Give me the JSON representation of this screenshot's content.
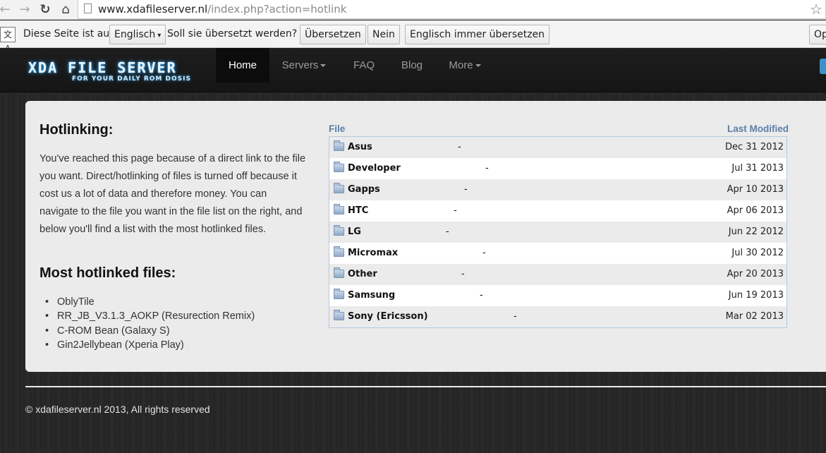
{
  "browser": {
    "url_domain": "www.xdafileserver.nl",
    "url_path": "/index.php?action=hotlink",
    "back_icon": "back-arrow-icon",
    "forward_icon": "forward-arrow-icon",
    "reload_icon": "reload-icon",
    "home_icon": "home-icon",
    "bookmark_icon": "star-icon"
  },
  "translate_bar": {
    "prefix": "Diese Seite ist auf",
    "language": "Englisch",
    "question": "Soll sie übersetzt werden?",
    "translate_label": "Übersetzen",
    "no_label": "Nein",
    "always_label": "Englisch immer übersetzen",
    "options_label": "Op"
  },
  "site": {
    "logo_title": "XDA FILE SERVER",
    "logo_tagline": "FOR YOUR DAILY ROM DOSIS",
    "nav": [
      {
        "label": "Home",
        "active": true
      },
      {
        "label": "Servers",
        "dropdown": true
      },
      {
        "label": "FAQ"
      },
      {
        "label": "Blog"
      },
      {
        "label": "More",
        "dropdown": true
      }
    ],
    "accent_color": "#2aa8ff"
  },
  "main": {
    "heading": "Hotlinking:",
    "intro": "You've reached this page because of a direct link to the file you want. Direct/hotlinking of files is turned off because it cost us a lot of data and therefore money. You can navigate to the file you want in the file list on the right, and below you'll find a list with the most hotlinked files.",
    "most_heading": "Most hotlinked files:",
    "most_hotlinked": [
      "OblyTile",
      "RR_JB_V3.1.3_AOKP (Resurection Remix)",
      "C-ROM Bean (Galaxy S)",
      "Gin2Jellybean (Xperia Play)"
    ]
  },
  "file_table": {
    "col_file": "File",
    "col_modified": "Last Modified",
    "rows": [
      {
        "name": "Asus",
        "size": "-",
        "modified": "Dec 31 2012"
      },
      {
        "name": "Developer",
        "size": "-",
        "modified": "Jul 31 2013"
      },
      {
        "name": "Gapps",
        "size": "-",
        "modified": "Apr 10 2013"
      },
      {
        "name": "HTC",
        "size": "-",
        "modified": "Apr 06 2013"
      },
      {
        "name": "LG",
        "size": "-",
        "modified": "Jun 22 2012"
      },
      {
        "name": "Micromax",
        "size": "-",
        "modified": "Jul 30 2012"
      },
      {
        "name": "Other",
        "size": "-",
        "modified": "Apr 20 2013"
      },
      {
        "name": "Samsung",
        "size": "-",
        "modified": "Jun 19 2013"
      },
      {
        "name": "Sony (Ericsson)",
        "size": "-",
        "modified": "Mar 02 2013"
      }
    ]
  },
  "footer": {
    "copyright": "© xdafileserver.nl 2013, All rights reserved"
  }
}
